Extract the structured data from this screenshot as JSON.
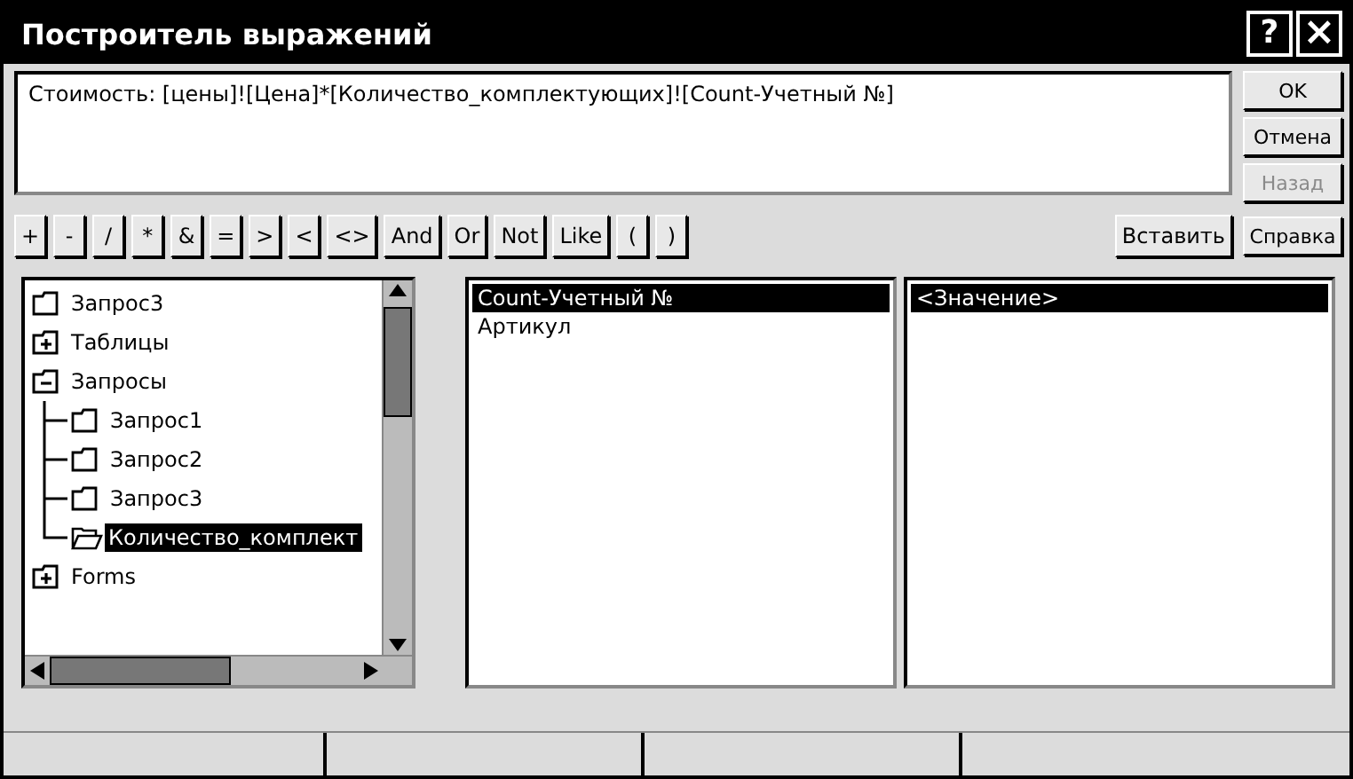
{
  "window": {
    "title": "Построитель выражений",
    "buttons": [
      {
        "kind": "help",
        "label": "?"
      },
      {
        "kind": "close",
        "label": "×"
      }
    ]
  },
  "expression": {
    "value": "Стоимость: [цены]![Цена]*[Количество_комплектующих]![Count-Учетный №]"
  },
  "side_buttons": [
    {
      "label": "OK",
      "disabled": false
    },
    {
      "label": "Отмена",
      "disabled": false
    },
    {
      "label": "Назад",
      "disabled": true
    },
    {
      "label": "Справка",
      "disabled": false
    }
  ],
  "operators": [
    "+",
    "-",
    "/",
    "*",
    "&",
    "=",
    ">",
    "<",
    "<>",
    "And",
    "Or",
    "Not",
    "Like",
    "(",
    ")"
  ],
  "insert_button": "Вставить",
  "tree": [
    {
      "label": "Запрос3",
      "kind": "folder",
      "selected": false
    },
    {
      "label": "Таблицы",
      "kind": "group",
      "expanded": false,
      "selected": false
    },
    {
      "label": "Запросы",
      "kind": "group",
      "expanded": true,
      "selected": false,
      "children": [
        {
          "label": "Запрос1",
          "kind": "folder",
          "selected": false
        },
        {
          "label": "Запрос2",
          "kind": "folder",
          "selected": false
        },
        {
          "label": "Запрос3",
          "kind": "folder",
          "selected": false
        },
        {
          "label": "Количество_комплект",
          "kind": "open-folder",
          "selected": true
        }
      ]
    },
    {
      "label": "Forms",
      "kind": "group",
      "expanded": false,
      "selected": false
    }
  ],
  "fields": [
    {
      "label": "Count-Учетный №",
      "selected": true
    },
    {
      "label": "Артикул",
      "selected": false
    }
  ],
  "values": [
    {
      "label": "<Значение>",
      "selected": true
    }
  ]
}
